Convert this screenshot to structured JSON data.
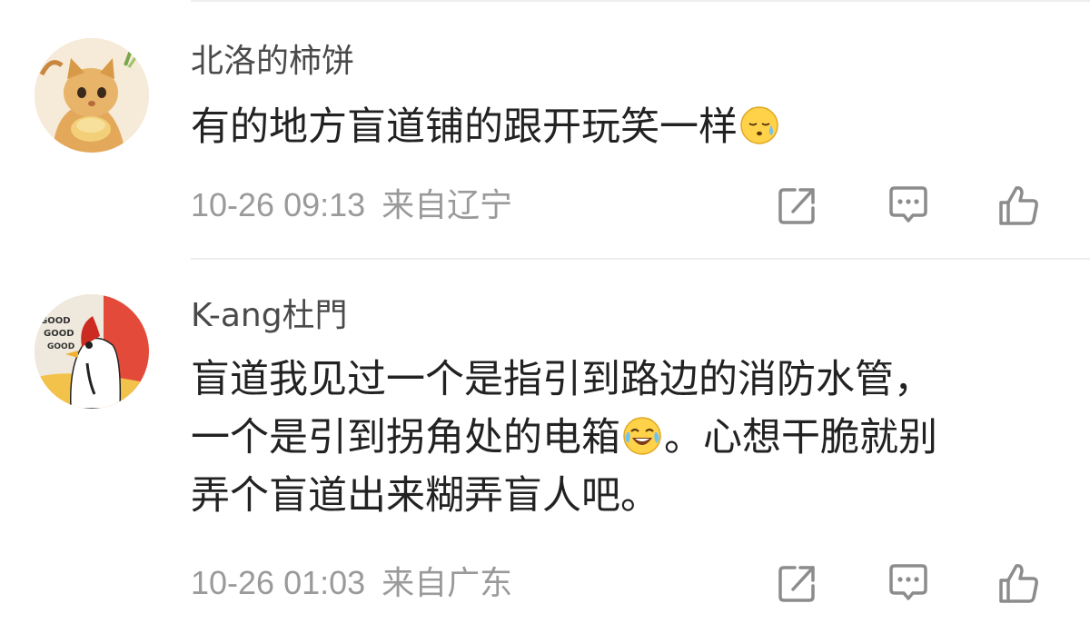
{
  "comments": [
    {
      "username": "北洛的柿饼",
      "text_before": "有的地方盲道铺的跟开玩笑一样",
      "emoji": "sleepy-sweat-emoji",
      "text_after": "",
      "time": "10-26 09:13",
      "location": "来自辽宁",
      "avatar": "cartoon-cat-avatar"
    },
    {
      "username": "K-ang杜門",
      "line1": "盲道我见过一个是指引到路边的消防水管，",
      "line2_before": "一个是引到拐角处的电箱",
      "emoji": "laugh-cry-emoji",
      "line2_after": "。心想干脆就别",
      "line3": "弄个盲道出来糊弄盲人吧。",
      "time": "10-26 01:03",
      "location": "来自广东",
      "avatar": "rooster-avatar",
      "avatar_text": [
        "GOOD",
        "GOOD",
        "GOOD"
      ]
    }
  ],
  "icons": {
    "share": "share-icon",
    "reply": "comment-icon",
    "like": "thumbs-up-icon"
  },
  "colors": {
    "username": "#4a4a4a",
    "text": "#222222",
    "meta": "#9a9a9a",
    "icon": "#8c8c8c",
    "divider": "#eeeeee"
  }
}
